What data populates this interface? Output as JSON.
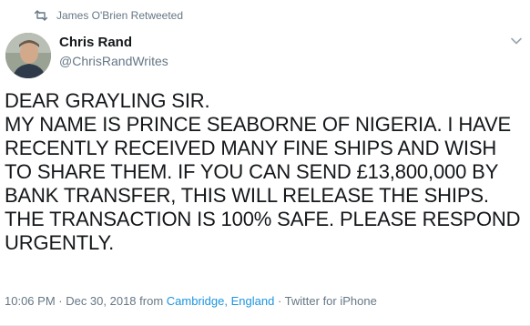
{
  "retweet": {
    "icon": "retweet-icon",
    "text": "James O'Brien Retweeted"
  },
  "author": {
    "display_name": "Chris Rand",
    "handle": "@ChrisRandWrites",
    "avatar_icon": "avatar-photo"
  },
  "menu_icon": "chevron-down-icon",
  "tweet": {
    "text": "DEAR GRAYLING SIR.\nMY NAME IS PRINCE SEABORNE OF NIGERIA. I HAVE RECENTLY RECEIVED MANY FINE SHIPS AND WISH TO SHARE THEM. IF YOU CAN SEND £13,800,000 BY BANK TRANSFER, THIS WILL RELEASE THE SHIPS. THE TRANSACTION IS 100% SAFE. PLEASE RESPOND URGENTLY."
  },
  "meta": {
    "timestamp": "10:06 PM · Dec 30, 2018",
    "from": "from",
    "location": "Cambridge, England",
    "separator": "·",
    "source": "Twitter for iPhone"
  },
  "colors": {
    "text": "#14171a",
    "secondary": "#657786",
    "link": "#1b95e0"
  }
}
